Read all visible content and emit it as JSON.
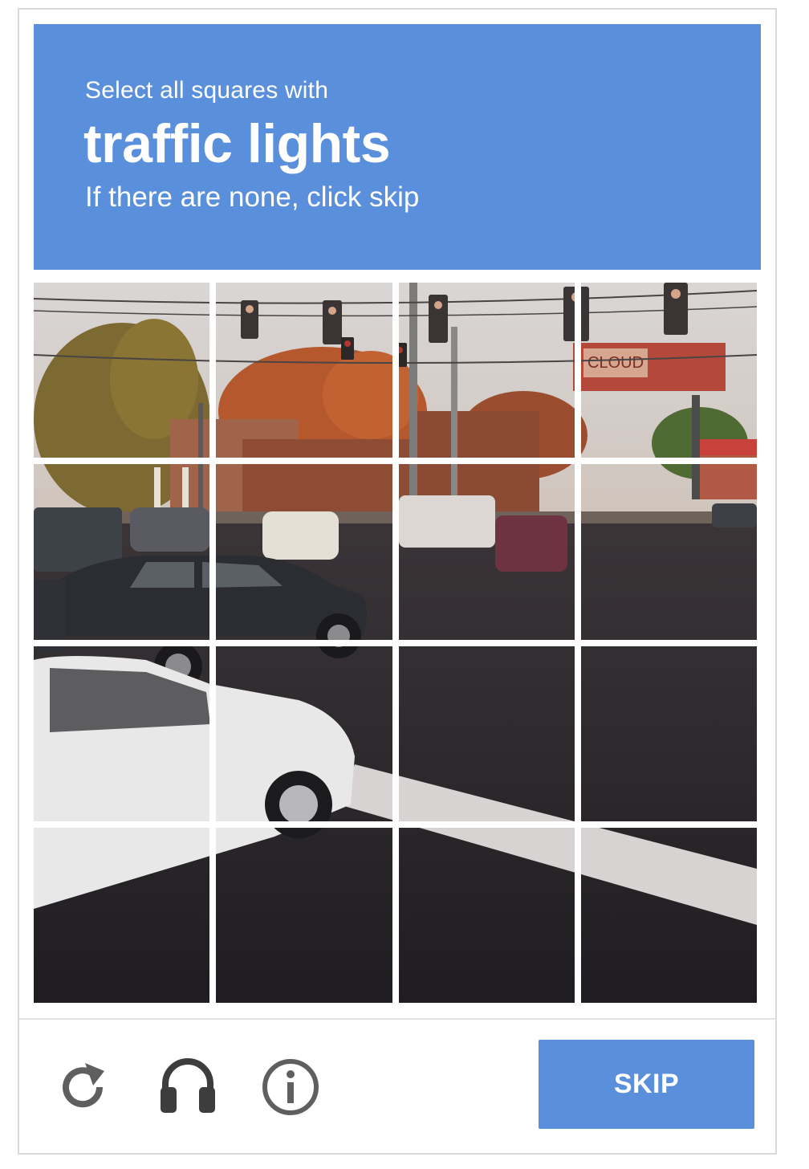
{
  "challenge": {
    "instruction_prefix": "Select all squares with",
    "target_object": "traffic lights",
    "instruction_suffix": "If there are none, click skip",
    "header_color": "#5a8fdc"
  },
  "grid": {
    "rows": 4,
    "columns": 4,
    "tiles": [
      {
        "row": 1,
        "col": 1
      },
      {
        "row": 1,
        "col": 2
      },
      {
        "row": 1,
        "col": 3
      },
      {
        "row": 1,
        "col": 4
      },
      {
        "row": 2,
        "col": 1
      },
      {
        "row": 2,
        "col": 2
      },
      {
        "row": 2,
        "col": 3
      },
      {
        "row": 2,
        "col": 4
      },
      {
        "row": 3,
        "col": 1
      },
      {
        "row": 3,
        "col": 2
      },
      {
        "row": 3,
        "col": 3
      },
      {
        "row": 3,
        "col": 4
      },
      {
        "row": 4,
        "col": 1
      },
      {
        "row": 4,
        "col": 2
      },
      {
        "row": 4,
        "col": 3
      },
      {
        "row": 4,
        "col": 4
      }
    ],
    "billboard_text": "CLOUD"
  },
  "footer": {
    "reload_icon": "reload-icon",
    "audio_icon": "headphones-icon",
    "info_icon": "info-icon",
    "skip_label": "SKIP",
    "accent_color": "#5a8fdc"
  }
}
